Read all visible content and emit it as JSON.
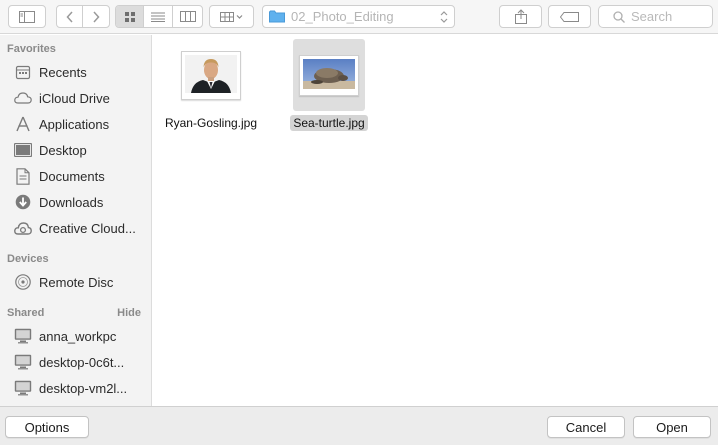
{
  "toolbar": {
    "current_folder": "02_Photo_Editing",
    "search_placeholder": "Search"
  },
  "sidebar": {
    "favorites_title": "Favorites",
    "favorites": [
      {
        "label": "Recents",
        "icon": "recents-icon"
      },
      {
        "label": "iCloud Drive",
        "icon": "cloud-icon"
      },
      {
        "label": "Applications",
        "icon": "applications-icon"
      },
      {
        "label": "Desktop",
        "icon": "desktop-icon"
      },
      {
        "label": "Documents",
        "icon": "documents-icon"
      },
      {
        "label": "Downloads",
        "icon": "downloads-icon"
      },
      {
        "label": "Creative Cloud...",
        "icon": "creative-cloud-icon"
      }
    ],
    "devices_title": "Devices",
    "devices": [
      {
        "label": "Remote Disc",
        "icon": "disc-icon"
      }
    ],
    "shared_title": "Shared",
    "shared_hide": "Hide",
    "shared": [
      {
        "label": "anna_workpc",
        "icon": "computer-icon"
      },
      {
        "label": "desktop-0c6t...",
        "icon": "computer-icon"
      },
      {
        "label": "desktop-vm2l...",
        "icon": "computer-icon"
      }
    ]
  },
  "files": [
    {
      "name": "Ryan-Gosling.jpg",
      "selected": false
    },
    {
      "name": "Sea-turtle.jpg",
      "selected": true
    }
  ],
  "buttons": {
    "options": "Options",
    "cancel": "Cancel",
    "open": "Open"
  },
  "colors": {
    "folder_blue": "#5fb1ee",
    "selection_gray": "#d4d4d4"
  }
}
